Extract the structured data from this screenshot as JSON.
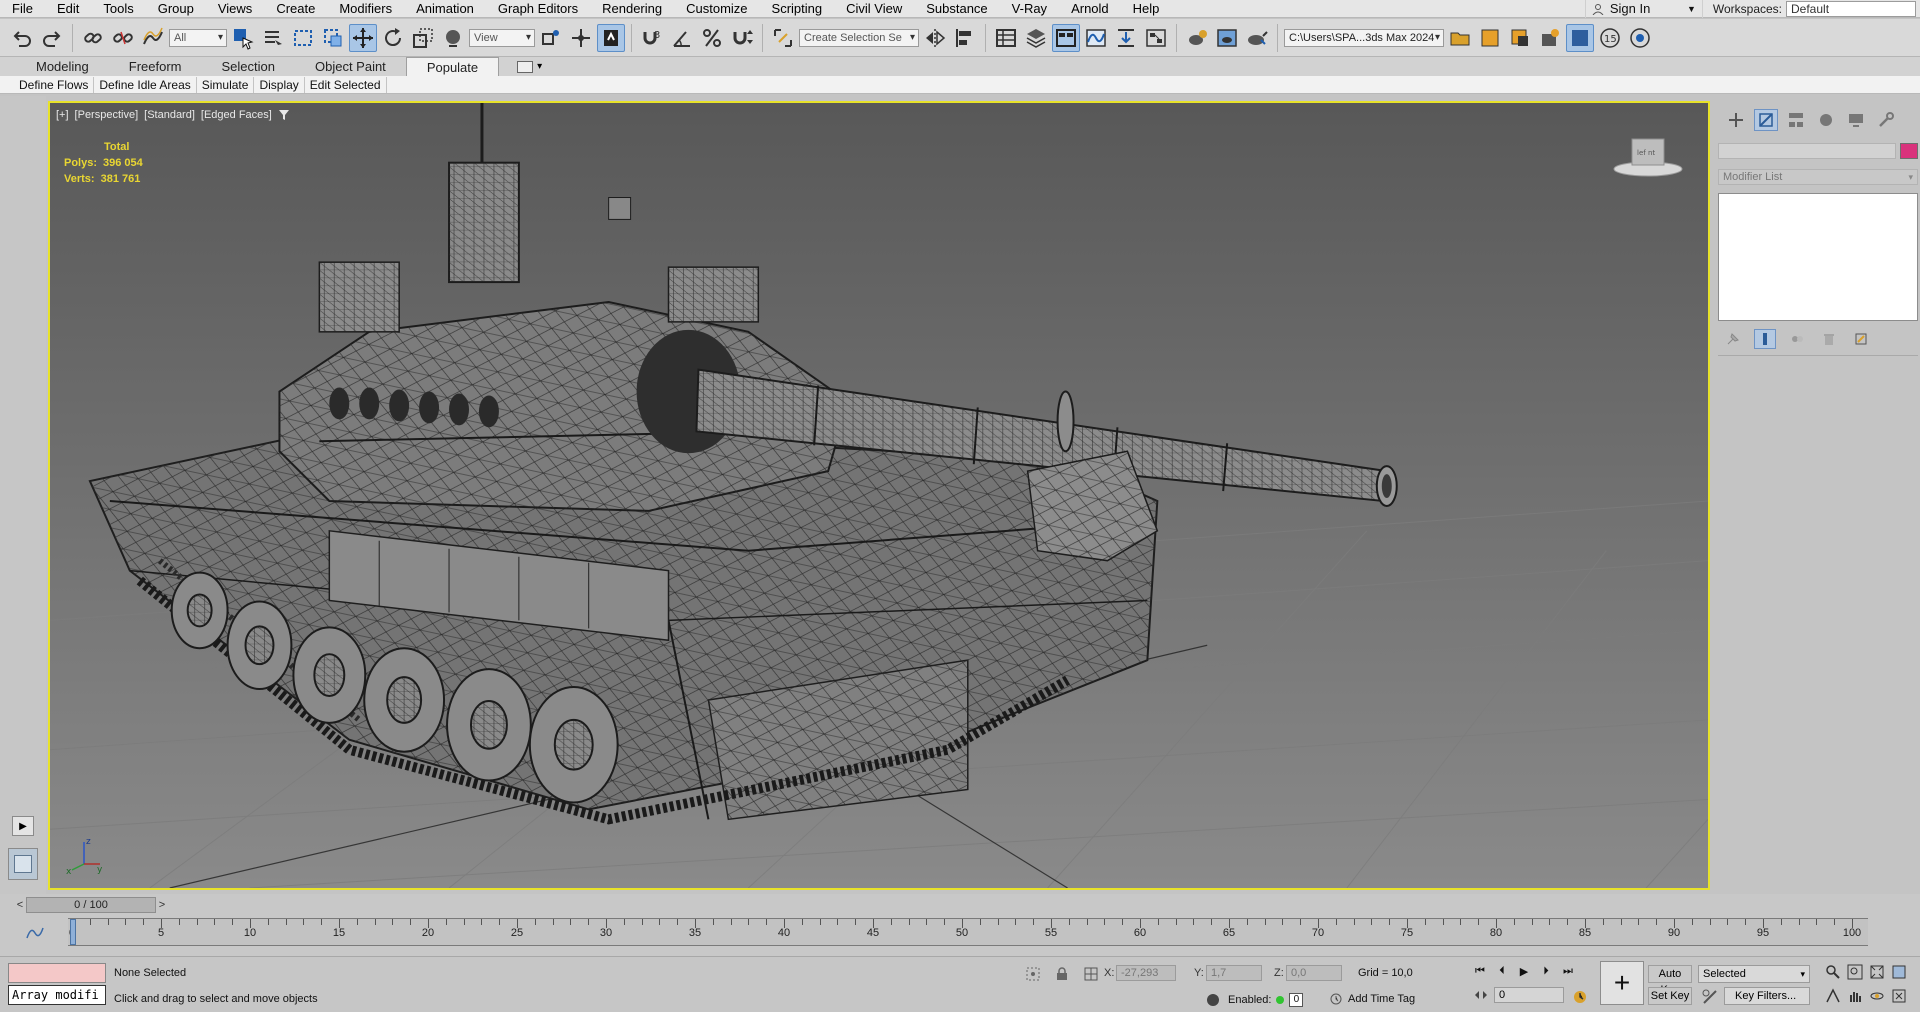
{
  "menu": [
    "File",
    "Edit",
    "Tools",
    "Group",
    "Views",
    "Create",
    "Modifiers",
    "Animation",
    "Graph Editors",
    "Rendering",
    "Customize",
    "Scripting",
    "Civil View",
    "Substance",
    "V-Ray",
    "Arnold",
    "Help"
  ],
  "account": {
    "sign_in": "Sign In"
  },
  "workspaces": {
    "label": "Workspaces:",
    "value": "Default"
  },
  "toolbar": {
    "filter_value": "All",
    "ref_coord_value": "View",
    "selection_set": "Create Selection Se",
    "project_path": "C:\\Users\\SPA...3ds Max 2024"
  },
  "ribbon": {
    "tabs": [
      "Modeling",
      "Freeform",
      "Selection",
      "Object Paint",
      "Populate"
    ],
    "active_tab": "Populate",
    "subtabs": [
      "Define Flows",
      "Define Idle Areas",
      "Simulate",
      "Display",
      "Edit Selected"
    ]
  },
  "viewport": {
    "label": {
      "plus": "[+]",
      "view": "[Perspective]",
      "shading": "[Standard]",
      "mode": "[Edged Faces]"
    },
    "stats": {
      "total_label": "Total",
      "polys_label": "Polys:",
      "polys_value": "396 054",
      "verts_label": "Verts:",
      "verts_value": "381 761"
    },
    "border_color": "#e7e229"
  },
  "command_panel": {
    "modifier_list": "Modifier List",
    "object_color": "#d9327c"
  },
  "timeline": {
    "frame_display": "0 / 100",
    "labels": [
      "0",
      "5",
      "10",
      "15",
      "20",
      "25",
      "30",
      "35",
      "40",
      "45",
      "50",
      "55",
      "60",
      "65",
      "70",
      "75",
      "80",
      "85",
      "90",
      "95",
      "100"
    ]
  },
  "status": {
    "selection": "None Selected",
    "prompt": "Click and drag to select and move objects",
    "maxscript": "Array modifi",
    "x_label": "X:",
    "x_value": "-27,293",
    "y_label": "Y:",
    "y_value": "1,7",
    "z_label": "Z:",
    "z_value": "0,0",
    "grid": "Grid = 10,0",
    "enabled_label": "Enabled:",
    "enabled_value": "0",
    "add_time_tag": "Add Time Tag",
    "auto_key": "Auto Key",
    "set_key": "Set Key",
    "key_selected": "Selected",
    "key_filters": "Key Filters...",
    "current_frame": "0"
  }
}
